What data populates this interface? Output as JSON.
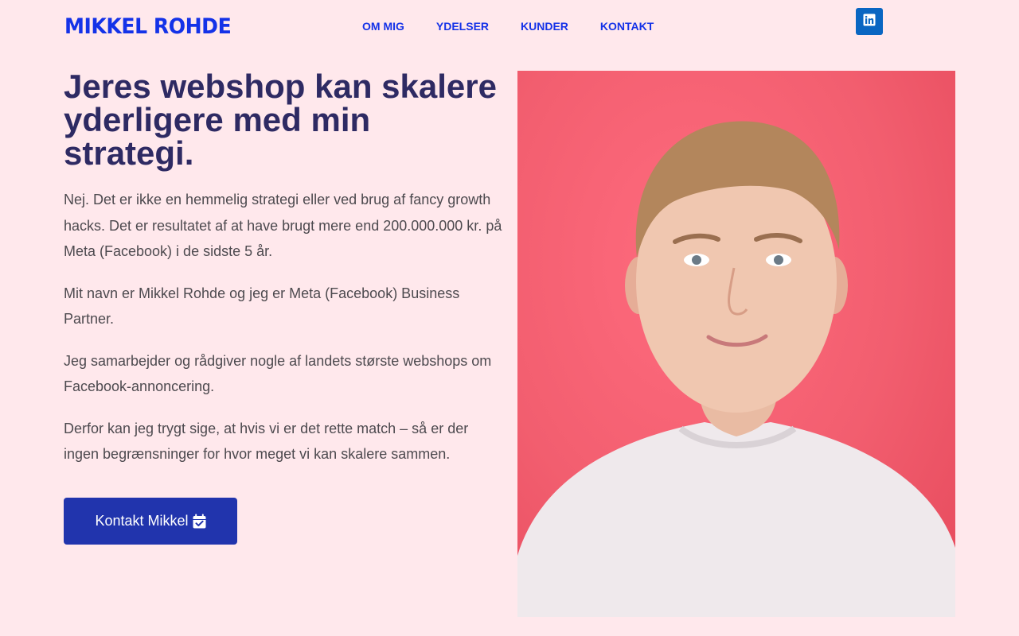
{
  "header": {
    "logo": "MIKKEL ROHDE",
    "nav": [
      "OM MIG",
      "YDELSER",
      "KUNDER",
      "KONTAKT"
    ],
    "social_icon": "linkedin-icon"
  },
  "hero": {
    "headline": "Jeres webshop kan skalere yderligere med min strategi.",
    "paragraphs": [
      "Nej. Det er ikke en hemmelig strategi eller ved brug af fancy growth hacks. Det er resultatet af at have brugt mere end 200.000.000 kr. på Meta (Facebook) i de sidste 5 år.",
      "Mit navn er Mikkel Rohde og jeg er Meta (Facebook) Business Partner.",
      "Jeg samarbejder og rådgiver nogle af landets største webshops om Facebook-annoncering.",
      "Derfor kan jeg trygt sige, at hvis vi er det rette match – så er der ingen begrænsninger for hvor meget vi kan skalere sammen."
    ],
    "cta_label": "Kontakt Mikkel",
    "cta_icon": "calendar-check-icon",
    "photo_alt": "portrait-photo"
  },
  "colors": {
    "background": "#ffe8ec",
    "brand_blue": "#1432e8",
    "headline": "#2e2a63",
    "button": "#2134ad",
    "linkedin": "#0a66c2",
    "photo_backdrop": "#f25e6f"
  }
}
